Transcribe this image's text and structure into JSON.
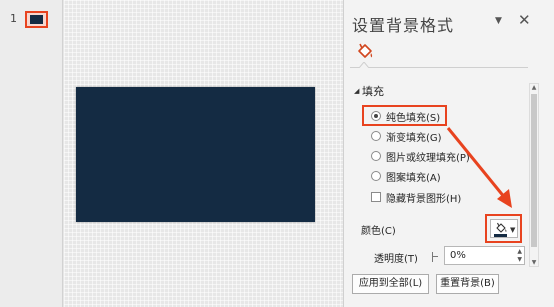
{
  "thumbnails": {
    "slide_number": "1"
  },
  "panel": {
    "title": "设置背景格式",
    "menu_icon": "dropdown-caret-icon",
    "close_icon": "close-icon",
    "fill_tab_icon": "paint-bucket-icon",
    "section_title": "填充",
    "options": [
      {
        "label": "纯色填充(S)",
        "type": "radio",
        "selected": true
      },
      {
        "label": "渐变填充(G)",
        "type": "radio",
        "selected": false
      },
      {
        "label": "图片或纹理填充(P)",
        "type": "radio",
        "selected": false
      },
      {
        "label": "图案填充(A)",
        "type": "radio",
        "selected": false
      },
      {
        "label": "隐藏背景图形(H)",
        "type": "checkbox",
        "selected": false
      }
    ],
    "color_label": "颜色(C)",
    "color_value": "#142b43",
    "transparency_label": "透明度(T)",
    "transparency_value": "0%",
    "apply_all_button": "应用到全部(L)",
    "reset_button": "重置背景(B)"
  },
  "colors": {
    "slide_background": "#142b43",
    "annotation": "#e8431f"
  }
}
